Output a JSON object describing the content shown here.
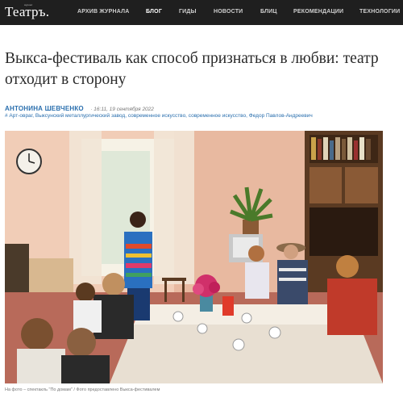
{
  "header": {
    "logo": "Театръ.",
    "logo_sup": "журнал",
    "nav": [
      {
        "label": "АРХИВ ЖУРНАЛА"
      },
      {
        "label": "БЛОГ"
      },
      {
        "label": "ГИДЫ"
      },
      {
        "label": "НОВОСТИ"
      },
      {
        "label": "БЛИЦ"
      },
      {
        "label": "РЕКОМЕНДАЦИИ"
      },
      {
        "label": "ТЕХНОЛОГИИ"
      }
    ],
    "active_nav": "БЛОГ"
  },
  "article": {
    "title": "Выкса-фестиваль как способ признаться в любви: театр отходит в сторону",
    "author": "АНТОНИНА ШЕВЧЕНКО",
    "date": "· 16:11, 19 сентября 2022",
    "tags": "# Арт-овраг, Выксунский металлургический завод, современное искусство, современное искусство, Федор Павлов-Андреевич",
    "photo_caption": "На фото – спектакль \"По домам\" / Фото предоставлено Выкса-фестивалем"
  },
  "colors": {
    "header_bg": "#1f1f1f",
    "link": "#2a6fae"
  }
}
